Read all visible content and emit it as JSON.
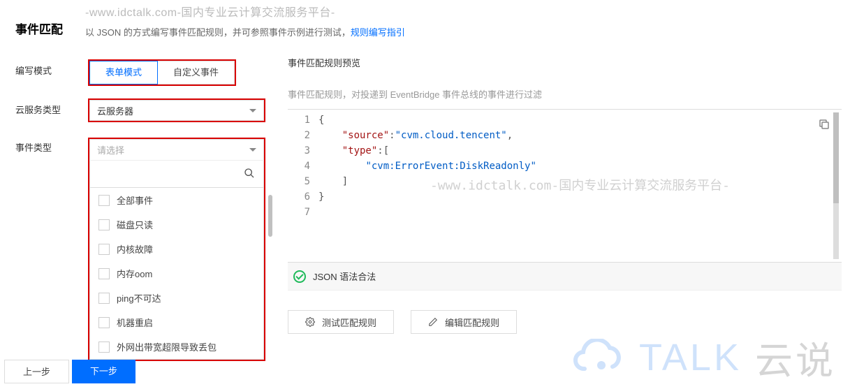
{
  "watermark_top": "-www.idctalk.com-国内专业云计算交流服务平台-",
  "title": "事件匹配",
  "desc_prefix": "以 JSON 的方式编写事件匹配规则，并可参照事件示例进行测试，",
  "desc_link": "规则编写指引",
  "rows": {
    "mode_label": "编写模式",
    "svc_label": "云服务类型",
    "evt_label": "事件类型"
  },
  "tabs": {
    "form": "表单模式",
    "custom": "自定义事件"
  },
  "svc_select": "云服务器",
  "evt_placeholder": "请选择",
  "evt_options": [
    "全部事件",
    "磁盘只读",
    "内核故障",
    "内存oom",
    "ping不可达",
    "机器重启",
    "外网出带宽超限导致丢包"
  ],
  "preview": {
    "title": "事件匹配规则预览",
    "desc": "事件匹配规则，对投递到 EventBridge 事件总线的事件进行过滤",
    "ok": "JSON 语法合法",
    "wm": "-www.idctalk.com-国内专业云计算交流服务平台-"
  },
  "code": {
    "source_key": "\"source\"",
    "source_val": "\"cvm.cloud.tencent\"",
    "type_key": "\"type\"",
    "type_val": "\"cvm:ErrorEvent:DiskReadonly\""
  },
  "buttons": {
    "test": "测试匹配规则",
    "edit": "编辑匹配规则"
  },
  "footer": {
    "prev": "上一步",
    "next": "下一步"
  },
  "wm_bottom": {
    "en": "TALK",
    "cn": "云说"
  }
}
